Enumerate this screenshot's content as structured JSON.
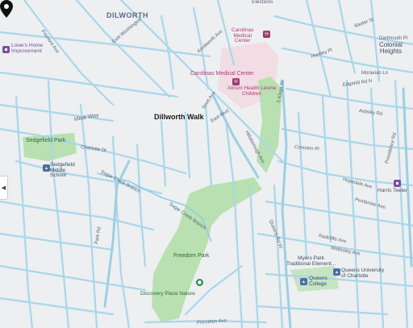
{
  "map": {
    "neighborhoods": {
      "dilworth": "DILWORTH"
    },
    "places": {
      "colonial_heights": "Colonial\nHeights",
      "carolinas_medical_center": "Carolinas\nMedical\nCenter",
      "carolinas_medical_center_2": "Carolinas Medical Center",
      "atrium_health": "Atrium Health Levine\nChildren",
      "lowes": "Lowe's Home\nImprovement",
      "sedgefield_park": "Sedgefield Park",
      "sedgefield_middle": "Sedgefield\nMiddle\nSchool",
      "freedom_park": "Freedom Park",
      "discovery_place": "Discovery Place Nature",
      "myers_park_traditional": "Myers Park\nTraditional Element...",
      "queens_university": "Queens University\nof Charlotte",
      "queens_college": "Queens\nCollege",
      "harris_teeter": "Harris Teeter",
      "elections": "Elections"
    },
    "selected_location": "Dillworth Walk",
    "road_labels": {
      "fremont": "Fremont Ave",
      "east_worthington": "East Worthington",
      "kenilworth": "Kenilworth Ave",
      "scott": "Scott Ave",
      "east_blvd": "East Blvd",
      "ideal_way": "Ideal Way",
      "sugar_creek_branch": "Sugar Creek Branch",
      "sugar_creek_branch_2": "Sugar Creek Branch",
      "park_rd": "Park Rd",
      "queens_rd_w": "Queens Rd W",
      "princeton": "Princeton Ave",
      "kings_dr": "S Kings Dr",
      "hillsborough": "Hillsborough Ave",
      "lombardy": "Lombardy Cir",
      "ardsley": "Ardsley Rd",
      "providence": "Providence Rd",
      "sterling": "Sterling Rd",
      "huntley": "Huntley Pl",
      "baxter": "Baxter St",
      "avondale": "Avondale Ave",
      "denver": "Denver Ave",
      "charlotte_dr": "Charlotte Dr",
      "myrtle": "Myrtle Ave",
      "dartmouth": "Dartmouth Pl",
      "moravian": "Moravian Ln",
      "edgehill": "Edgehill Rd N",
      "cherokee": "Cherokee Rd",
      "selwyn": "Selwyn Ave",
      "radcliffe": "Radcliffe Ave",
      "wellesley": "Wellesley Ave",
      "mt_vernon": "Mt Vernon Ave",
      "hermitage": "Hermitage Rd",
      "hopedale": "Hopedale Ave",
      "pembroke": "Pembroke Ave",
      "coniston": "Coniston Pl",
      "westfield": "Westfield Rd",
      "belvedere": "Belvedere Ave"
    },
    "side_handle_icon": "chevron-left-icon",
    "colors": {
      "road": "#a9d7ea",
      "park": "#b8e0b0",
      "hospital_area": "#f1dde3",
      "creek": "#8fcde6",
      "pin": "#111111"
    }
  }
}
